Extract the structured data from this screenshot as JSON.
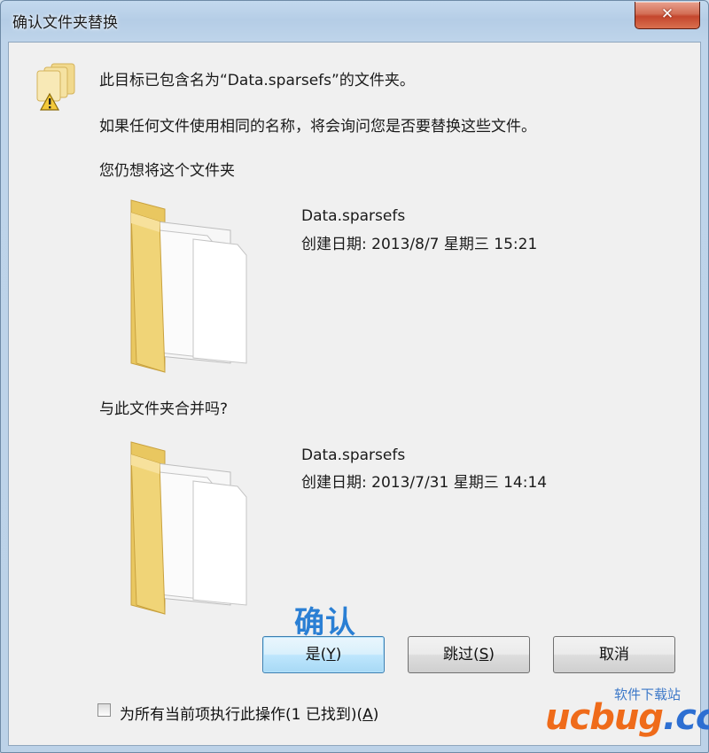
{
  "window": {
    "title": "确认文件夹替换",
    "close_icon": "close-icon",
    "close_symbol": "✕"
  },
  "dialog": {
    "icon": "folder-warning-icon",
    "message_line1": "此目标已包含名为“Data.sparsefs”的文件夹。",
    "message_line2": "如果任何文件使用相同的名称，将会询问您是否要替换这些文件。",
    "prompt_keep": "您仍想将这个文件夹",
    "target_folder": {
      "name": "Data.sparsefs",
      "created": "创建日期: 2013/8/7 星期三 15:21",
      "icon": "folder-icon"
    },
    "prompt_merge": "与此文件夹合并吗?",
    "source_folder": {
      "name": "Data.sparsefs",
      "created": "创建日期: 2013/7/31 星期三 14:14",
      "icon": "folder-icon"
    },
    "annotation": "确认"
  },
  "buttons": {
    "yes": {
      "text": "是(",
      "key": "Y",
      "end": ")"
    },
    "skip": {
      "text": "跳过(",
      "key": "S",
      "end": ")"
    },
    "cancel": "取消"
  },
  "checkbox": {
    "label_text": "为所有当前项执行此操作(1 已找到)(",
    "label_key": "A",
    "label_end": ")",
    "checked": false
  },
  "watermark": {
    "top": "软件下载站",
    "prefix": "ucbug",
    "suffix": ".cc",
    "colors": {
      "orange": "#ef6b1a",
      "blue": "#2d6fd2"
    }
  },
  "colors": {
    "annotation": "#2a7fd4",
    "titlebar": "#bcd2e8",
    "close_button": "#c4462d"
  }
}
